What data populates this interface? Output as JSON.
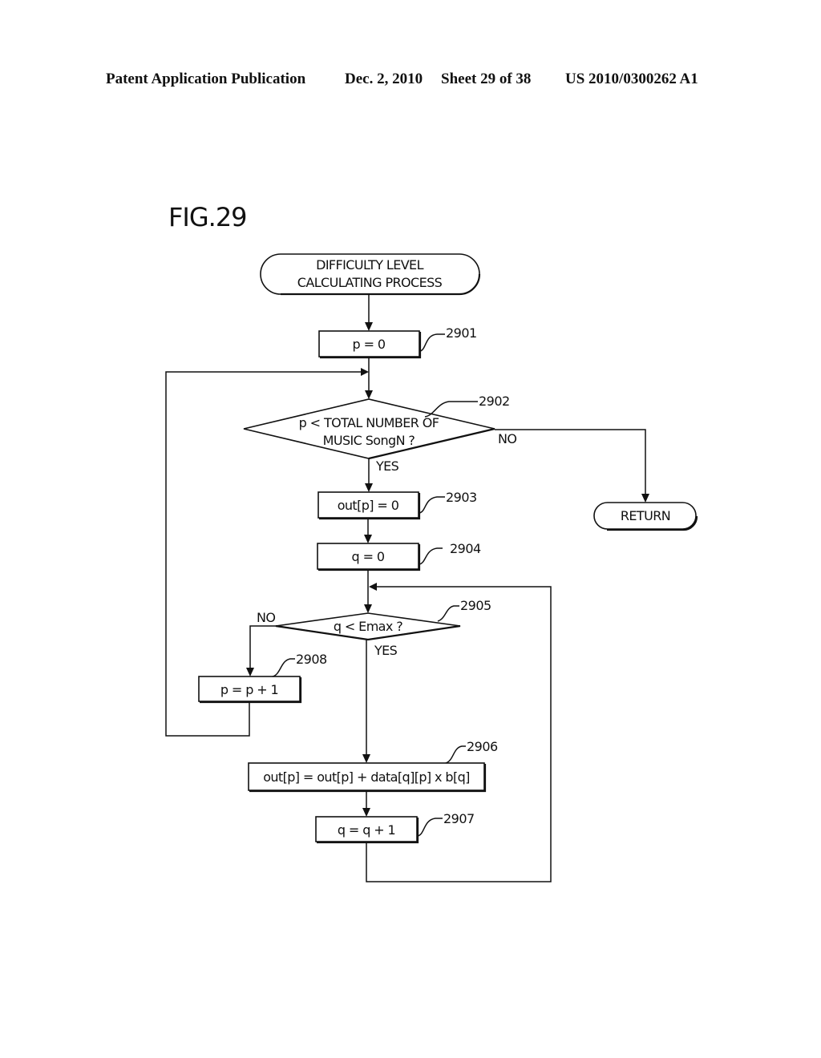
{
  "header": {
    "publication": "Patent Application Publication",
    "date": "Dec. 2, 2010",
    "sheet": "Sheet 29 of 38",
    "number": "US 2010/0300262 A1"
  },
  "figure": {
    "label": "FIG.29",
    "start": {
      "line1": "DIFFICULTY LEVEL",
      "line2": "CALCULATING PROCESS"
    },
    "steps": {
      "s2901": {
        "text": "p = 0",
        "ref": "2901"
      },
      "s2902": {
        "line1": "p < TOTAL NUMBER OF",
        "line2": "MUSIC SongN ?",
        "ref": "2902",
        "yes": "YES",
        "no": "NO"
      },
      "s2903": {
        "text": "out[p] = 0",
        "ref": "2903"
      },
      "s2904": {
        "text": "q = 0",
        "ref": "2904"
      },
      "s2905": {
        "text": "q < Emax ?",
        "ref": "2905",
        "yes": "YES",
        "no": "NO"
      },
      "s2906": {
        "text": "out[p] = out[p] + data[q][p] x b[q]",
        "ref": "2906"
      },
      "s2907": {
        "text": "q = q + 1",
        "ref": "2907"
      },
      "s2908": {
        "text": "p = p + 1",
        "ref": "2908"
      }
    },
    "return": "RETURN"
  }
}
